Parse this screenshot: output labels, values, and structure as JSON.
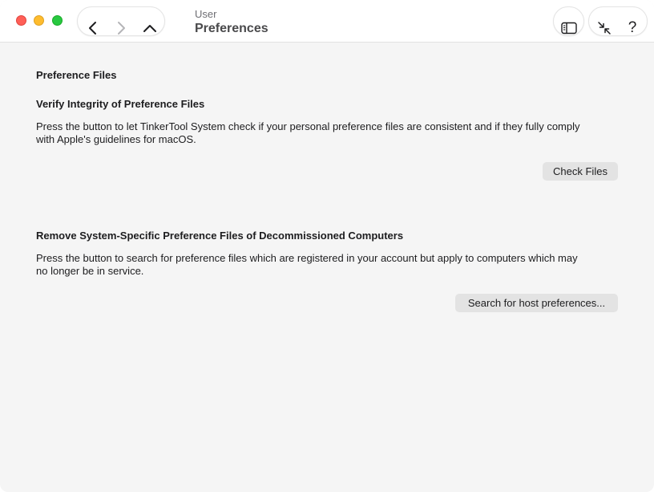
{
  "window": {
    "subtitle": "User",
    "title": "Preferences"
  },
  "toolbar": {
    "help_label": "?"
  },
  "section": {
    "heading": "Preference Files"
  },
  "verify": {
    "heading": "Verify Integrity of Preference Files",
    "description_line1": "Press the button to let TinkerTool System check if your personal preference files are consistent and if they fully comply",
    "description_line2": "with Apple's guidelines for macOS.",
    "button_label": "Check Files"
  },
  "remove": {
    "heading": "Remove System-Specific Preference Files of Decommissioned Computers",
    "description_line1": "Press the button to search for preference files which are registered in your account but apply to computers which may",
    "description_line2": "no longer be in service.",
    "button_label": "Search for host preferences..."
  },
  "colors": {
    "close": "#ff5f57",
    "minimize": "#febc2e",
    "zoom": "#28c840",
    "background": "#f5f5f5",
    "button": "#e3e3e3"
  }
}
